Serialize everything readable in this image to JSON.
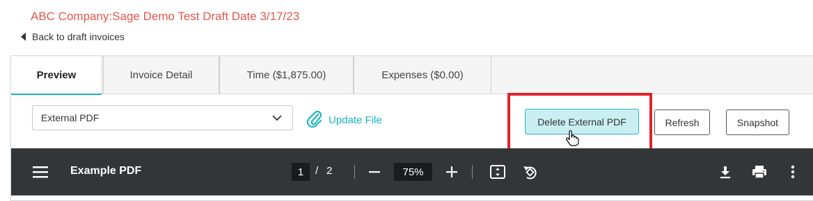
{
  "header": {
    "title": "ABC Company:Sage Demo Test Draft Date 3/17/23",
    "back_label": "Back to draft invoices"
  },
  "tabs": [
    {
      "label": "Preview",
      "active": true
    },
    {
      "label": "Invoice Detail",
      "active": false
    },
    {
      "label": "Time ($1,875.00)",
      "active": false
    },
    {
      "label": "Expenses ($0.00)",
      "active": false
    }
  ],
  "toolbar": {
    "select_value": "External PDF",
    "update_file_label": "Update File",
    "delete_label": "Delete External PDF",
    "refresh_label": "Refresh",
    "snapshot_label": "Snapshot"
  },
  "pdf_viewer": {
    "title": "Example PDF",
    "current_page": "1",
    "separator": "/",
    "total_pages": "2",
    "zoom": "75%"
  },
  "colors": {
    "title": "#e2574c",
    "accent": "#1ab5c1",
    "highlight": "#e0242b",
    "viewer_bar": "#323639"
  },
  "icons": [
    "chevron-left-icon",
    "chevron-down-icon",
    "paperclip-icon",
    "hand-cursor-icon",
    "menu-icon",
    "minus-icon",
    "plus-icon",
    "fit-page-icon",
    "rotate-icon",
    "download-icon",
    "print-icon",
    "more-vert-icon"
  ]
}
